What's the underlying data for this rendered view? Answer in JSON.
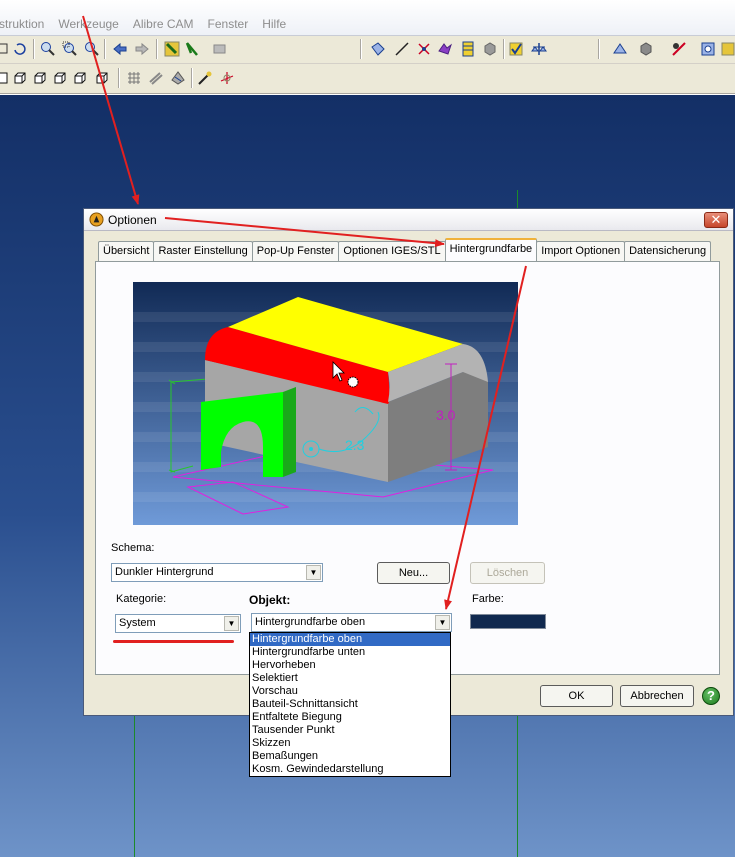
{
  "menubar": {
    "items": [
      "struktion",
      "Werkzeuge",
      "Alibre CAM",
      "Fenster",
      "Hilfe"
    ]
  },
  "toolbar": {
    "row1_icons": [
      "pan-icon",
      "rotate-icon",
      "zoom-in-icon",
      "zoom-window-icon",
      "zoom-out-icon",
      "back-arrow-icon",
      "forward-arrow-icon",
      "select-filter-icon",
      "flag-icon",
      "camera-icon",
      "sketch-icon",
      "line-icon",
      "point-icon",
      "constraint-icon",
      "table-icon",
      "cube-icon",
      "check-icon",
      "scale-icon",
      "view-icon",
      "shade-icon",
      "measure-icon",
      "assembly-icon",
      "bom-icon"
    ],
    "row2_icons": [
      "view-front-icon",
      "view-back-icon",
      "view-left-icon",
      "view-right-icon",
      "view-top-icon",
      "grid-icon",
      "snap-icon",
      "render-icon",
      "bug-icon",
      "axis-icon"
    ]
  },
  "dialog": {
    "title": "Optionen",
    "close_glyph": "✕",
    "tabs": [
      {
        "label": "Übersicht",
        "active": false
      },
      {
        "label": "Raster Einstellung",
        "active": false
      },
      {
        "label": "Pop-Up Fenster",
        "active": false
      },
      {
        "label": "Optionen IGES/STL",
        "active": false
      },
      {
        "label": "Hintergrundfarbe",
        "active": true
      },
      {
        "label": "Import Optionen",
        "active": false
      },
      {
        "label": "Datensicherung",
        "active": false
      }
    ],
    "preview": {
      "dimension_vertical": "3.0",
      "dimension_radius": "2.3"
    },
    "schema_label": "Schema:",
    "schema_value": "Dunkler Hintergrund",
    "new_button": "Neu...",
    "delete_button": "Löschen",
    "kategorie_label": "Kategorie:",
    "kategorie_value": "System",
    "objekt_label": "Objekt:",
    "objekt_value": "Hintergrundfarbe oben",
    "farbe_label": "Farbe:",
    "farbe_color": "#10294f",
    "ok_button": "OK",
    "cancel_button": "Abbrechen",
    "help_glyph": "?",
    "objekt_options": [
      "Hintergrundfarbe oben",
      "Hintergrundfarbe unten",
      "Hervorheben",
      "Selektiert",
      "Vorschau",
      "Bauteil-Schnittansicht",
      "Entfaltete Biegung",
      "Tausender Punkt",
      "Skizzen",
      "Bemaßungen",
      "Kosm. Gewindedarstellung"
    ],
    "selected_option_index": 0
  },
  "annotation_color": "#e12020"
}
